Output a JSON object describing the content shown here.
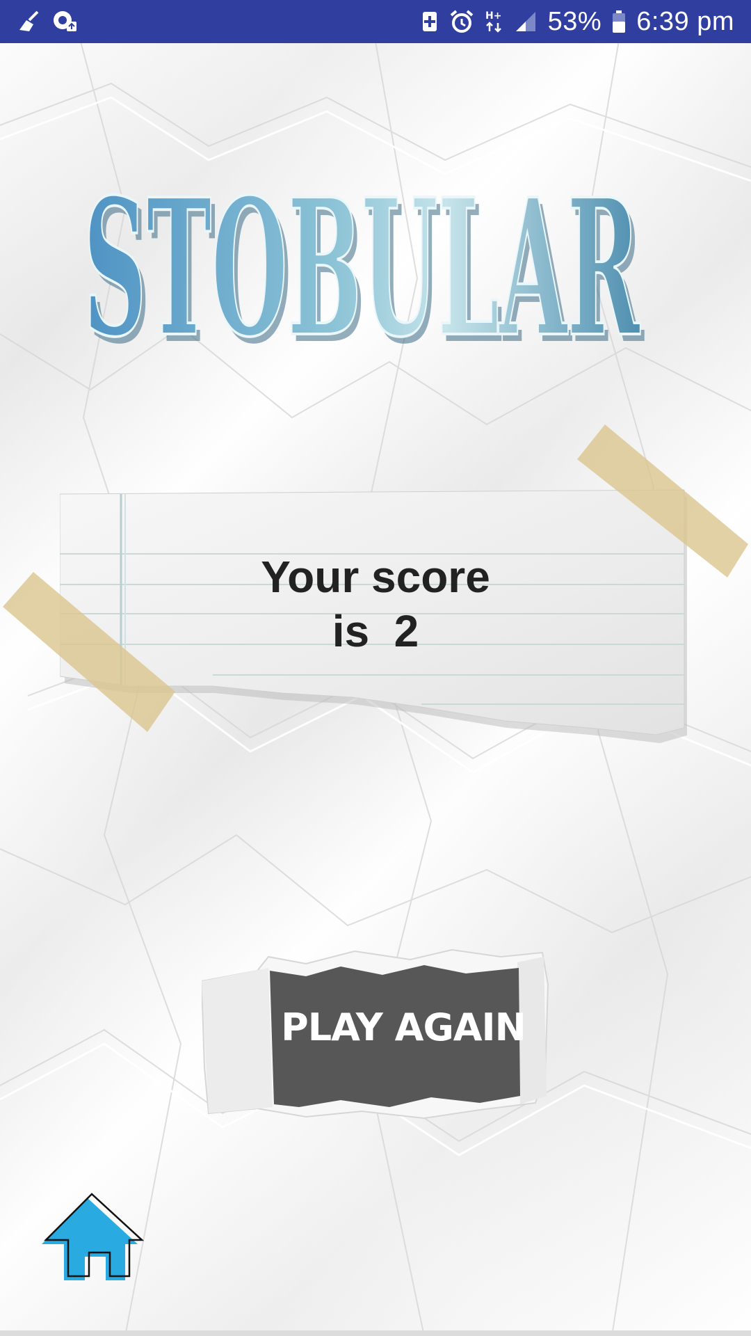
{
  "status_bar": {
    "battery_percent": "53%",
    "time": "6:39 pm",
    "network": "H+",
    "left_icons": [
      "cleaner-icon",
      "notification-upload-icon"
    ],
    "right_icons": [
      "battery-saver-icon",
      "alarm-icon",
      "network-type-icon",
      "signal-icon",
      "battery-icon"
    ],
    "background_color": "#303f9f"
  },
  "app": {
    "title": "STOBULAR",
    "title_color": "#6fa9c9"
  },
  "score_card": {
    "line1": "Your score",
    "line2": "is  2"
  },
  "play_again": {
    "label": "PLAY AGAIN"
  },
  "home": {
    "icon": "home-icon",
    "color": "#29abe2"
  }
}
